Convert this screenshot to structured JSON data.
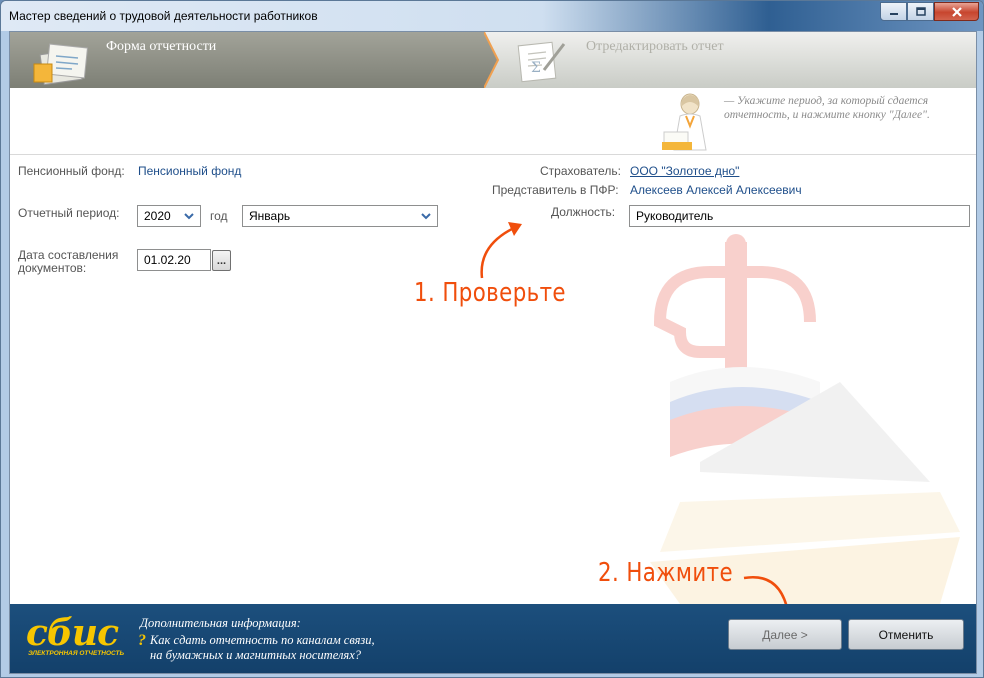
{
  "window": {
    "title": "Мастер сведений о трудовой деятельности работников"
  },
  "steps": {
    "current": "Форма отчетности",
    "next": "Отредактировать отчет"
  },
  "hint": {
    "text": "— Укажите период, за который сдается отчетность, и нажмите кнопку \"Далее\"."
  },
  "form": {
    "fund_label": "Пенсионный фонд:",
    "fund_value": "Пенсионный фонд",
    "period_label": "Отчетный период:",
    "year_value": "2020",
    "year_label": "год",
    "month_value": "Январь",
    "date_label_line1": "Дата составления",
    "date_label_line2": "документов:",
    "date_value": "01.02.20",
    "date_picker_label": "...",
    "insurer_label": "Страхователь:",
    "insurer_value": "ООО \"Золотое дно\"",
    "rep_label": "Представитель в ПФР:",
    "rep_value": "Алексеев Алексей Алексеевич",
    "position_label": "Должность:",
    "position_value": "Руководитель"
  },
  "annotations": {
    "check": "1. Проверьте",
    "press": "2. Нажмите"
  },
  "footer": {
    "logo_text": "сбис",
    "logo_sub": "ЭЛЕКТРОННАЯ ОТЧЕТНОСТЬ",
    "info_title": "Дополнительная информация:",
    "info_question_mark": "?",
    "info_link_line1": "Как сдать отчетность по каналам связи,",
    "info_link_line2": "на бумажных и магнитных носителях?",
    "next_button": "Далее >",
    "cancel_button": "Отменить"
  },
  "colors": {
    "accent_orange": "#f04e0c",
    "footer_blue": "#1c4f7d",
    "link_blue": "#1e4e8a",
    "logo_yellow": "#f7c600"
  }
}
